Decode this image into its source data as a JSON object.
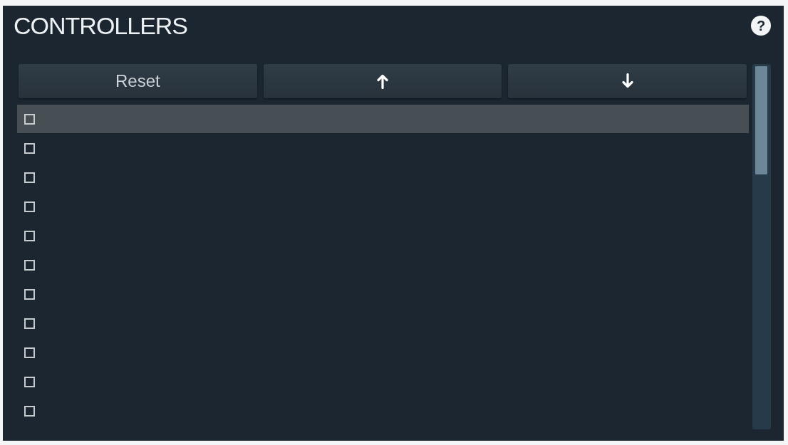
{
  "panel": {
    "title": "CONTROLLERS",
    "help_button": "?"
  },
  "buttons": [
    {
      "kind": "label",
      "label": "Reset"
    },
    {
      "kind": "up"
    },
    {
      "kind": "down"
    }
  ],
  "rows": [
    {
      "selected": true,
      "checked": false
    },
    {
      "selected": false,
      "checked": false
    },
    {
      "selected": false,
      "checked": false
    },
    {
      "selected": false,
      "checked": false
    },
    {
      "selected": false,
      "checked": false
    },
    {
      "selected": false,
      "checked": false
    },
    {
      "selected": false,
      "checked": false
    },
    {
      "selected": false,
      "checked": false
    },
    {
      "selected": false,
      "checked": false
    },
    {
      "selected": false,
      "checked": false
    },
    {
      "selected": false,
      "checked": false
    }
  ]
}
